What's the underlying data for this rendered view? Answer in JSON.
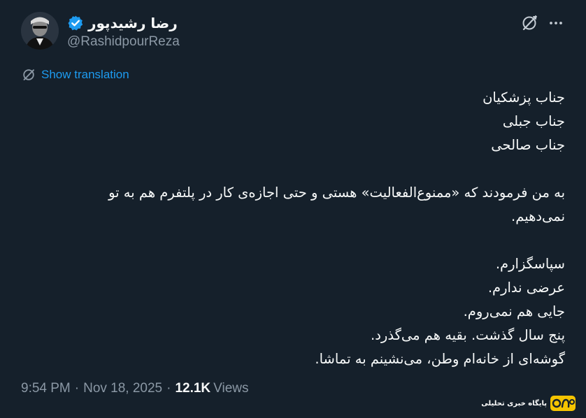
{
  "author": {
    "display_name": "رضا رشیدپور",
    "handle": "@RashidpourReza",
    "verified": true
  },
  "actions": {
    "grok_icon": "grok-icon",
    "more_icon": "more-icon"
  },
  "translation": {
    "label": "Show translation"
  },
  "tweet": {
    "lines": [
      "جناب پزشکیان",
      "جناب جبلی",
      "جناب صالحی",
      "",
      "به من فرمودند که «ممنوع‌الفعالیت» هستی و حتی اجازه‌ی کار در پلتفرم هم به تو",
      "نمی‌دهیم.",
      "",
      "سپاسگزارم.",
      "عرضی ندارم.",
      "جایی هم نمی‌روم.",
      "پنج سال گذشت. بقیه هم می‌گذرد.",
      "گوشه‌ای از خانه‌ام وطن، می‌نشینم به تماشا."
    ]
  },
  "meta": {
    "time": "9:54 PM",
    "separator": "·",
    "date": "Nov 18, 2025",
    "views_count": "12.1K",
    "views_label": "Views"
  },
  "watermark": {
    "logo_text": "روزنو",
    "caption": "پایگاه خبری تحلیلی"
  },
  "colors": {
    "background": "#15202b",
    "text": "#f7f9f9",
    "secondary": "#8b98a5",
    "link": "#1d9bf0",
    "verified": "#1d9bf0",
    "watermark_accent": "#f5c400"
  }
}
